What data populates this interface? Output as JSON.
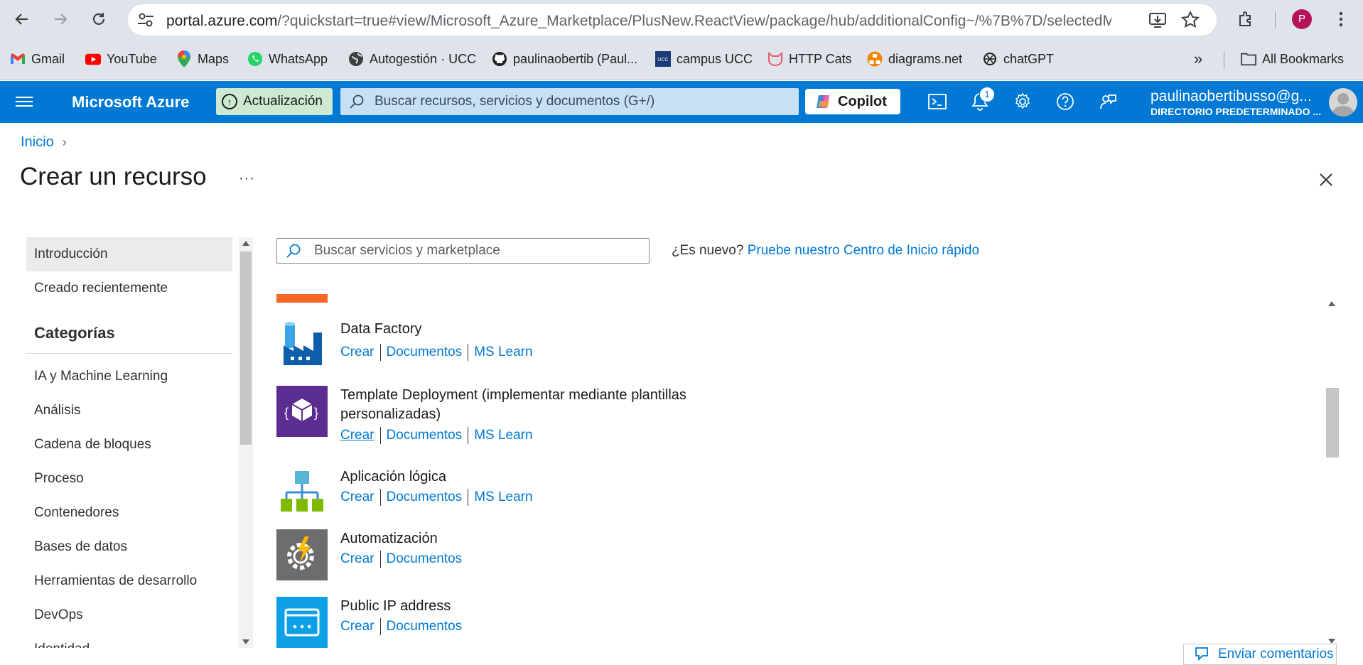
{
  "browser": {
    "url_host": "portal.azure.com",
    "url_rest": "/?quickstart=true#view/Microsoft_Azure_Marketplace/PlusNew.ReactView/package/hub/additionalConfig~/%7B%7D/selectedM...",
    "profile_initial": "P",
    "bookmarks": [
      {
        "label": "Gmail",
        "icon": "gmail-icon"
      },
      {
        "label": "YouTube",
        "icon": "youtube-icon"
      },
      {
        "label": "Maps",
        "icon": "maps-icon"
      },
      {
        "label": "WhatsApp",
        "icon": "whatsapp-icon"
      },
      {
        "label": "Autogestión · UCC",
        "icon": "globe-icon"
      },
      {
        "label": "paulinaobertib (Paul...",
        "icon": "github-icon"
      },
      {
        "label": "campus UCC",
        "icon": "ucc-icon"
      },
      {
        "label": "HTTP Cats",
        "icon": "cat-icon"
      },
      {
        "label": "diagrams.net",
        "icon": "diagrams-icon"
      },
      {
        "label": "chatGPT",
        "icon": "chatgpt-icon"
      }
    ],
    "all_bookmarks": "All Bookmarks"
  },
  "azure": {
    "brand": "Microsoft Azure",
    "update_label": "Actualización",
    "search_placeholder": "Buscar recursos, servicios y documentos (G+/)",
    "copilot_label": "Copilot",
    "notification_count": "1",
    "user_email": "paulinaobertibusso@g...",
    "user_directory": "DIRECTORIO PREDETERMINADO ..."
  },
  "page": {
    "breadcrumb_home": "Inicio",
    "title": "Crear un recurso",
    "more": "···"
  },
  "leftnav": {
    "top_items": [
      "Introducción",
      "Creado recientemente"
    ],
    "categories_heading": "Categorías",
    "categories": [
      "IA y Machine Learning",
      "Análisis",
      "Cadena de bloques",
      "Proceso",
      "Contenedores",
      "Bases de datos",
      "Herramientas de desarrollo",
      "DevOps",
      "Identidad"
    ]
  },
  "content": {
    "search_placeholder": "Buscar servicios y marketplace",
    "new_question": "¿Es nuevo?",
    "quickstart_link": "Pruebe nuestro Centro de Inicio rápido",
    "services": [
      {
        "name": "Data Factory",
        "create": "Crear",
        "docs": "Documentos",
        "learn": "MS Learn",
        "icon": "data-factory-icon"
      },
      {
        "name": "Template Deployment (implementar mediante plantillas personalizadas)",
        "create": "Crear",
        "docs": "Documentos",
        "learn": "MS Learn",
        "icon": "template-deployment-icon"
      },
      {
        "name": "Aplicación lógica",
        "create": "Crear",
        "docs": "Documentos",
        "learn": "MS Learn",
        "icon": "logic-app-icon"
      },
      {
        "name": "Automatización",
        "create": "Crear",
        "docs": "Documentos",
        "icon": "automation-icon"
      },
      {
        "name": "Public IP address",
        "create": "Crear",
        "docs": "Documentos",
        "icon": "public-ip-icon"
      }
    ],
    "feedback": "Enviar comentarios"
  },
  "colors": {
    "azure_blue": "#0078d4",
    "orange_accent": "#f56726",
    "template_purple": "#5c2d91",
    "automation_gray": "#6d6d6d",
    "public_ip_blue": "#0ea0e6"
  }
}
